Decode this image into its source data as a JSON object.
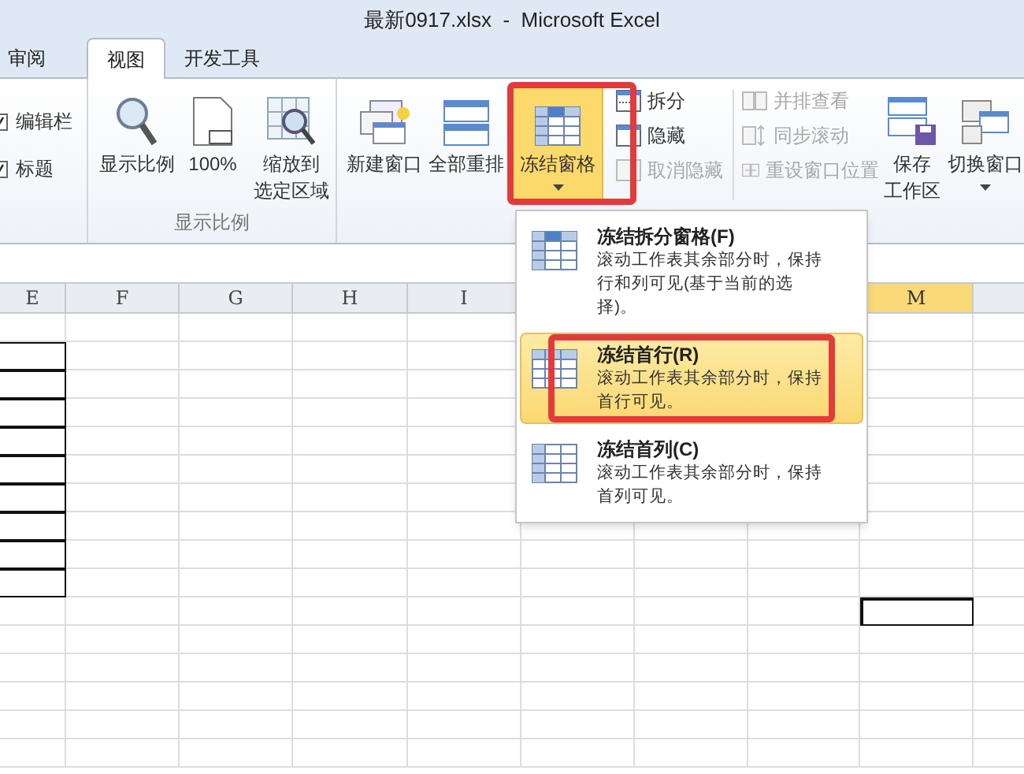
{
  "window": {
    "title": "最新0917.xlsx  -  Microsoft Excel"
  },
  "tabs": [
    {
      "label": "审阅",
      "selected": false
    },
    {
      "label": "视图",
      "selected": true
    },
    {
      "label": "开发工具",
      "selected": false
    }
  ],
  "show_group": {
    "checkboxes": [
      {
        "label": "编辑栏",
        "checked": true
      },
      {
        "label": "标题",
        "checked": true
      }
    ]
  },
  "zoom_group": {
    "label": "显示比例",
    "buttons": [
      {
        "kind": "zoom",
        "label": [
          "显示比例"
        ]
      },
      {
        "kind": "hundred",
        "label": [
          "100%"
        ]
      },
      {
        "kind": "selection",
        "label": [
          "缩放到",
          "选定区域"
        ]
      }
    ]
  },
  "window_group": {
    "large_buttons": [
      {
        "kind": "new",
        "label": [
          "新建窗口"
        ],
        "selected": false,
        "dropdown": false,
        "highlight_frame": false
      },
      {
        "kind": "arrange",
        "label": [
          "全部重排"
        ],
        "selected": false,
        "dropdown": false,
        "highlight_frame": false
      },
      {
        "kind": "freeze",
        "label": [
          "冻结窗格"
        ],
        "selected": true,
        "dropdown": true,
        "highlight_frame": true
      }
    ],
    "small_buttons": [
      {
        "kind": "split",
        "label": "拆分",
        "disabled": false
      },
      {
        "kind": "hide",
        "label": "隐藏",
        "disabled": false
      },
      {
        "kind": "unhide",
        "label": "取消隐藏",
        "disabled": true
      }
    ],
    "sync_buttons": [
      {
        "kind": "side",
        "label": "并排查看",
        "disabled": true
      },
      {
        "kind": "sync",
        "label": "同步滚动",
        "disabled": true
      },
      {
        "kind": "reset",
        "label": "重设窗口位置",
        "disabled": true
      }
    ],
    "end_buttons": [
      {
        "kind": "save",
        "label": [
          "保存",
          "工作区"
        ],
        "dropdown": false
      },
      {
        "kind": "switch",
        "label": [
          "切换窗口"
        ],
        "dropdown": true
      }
    ]
  },
  "freeze_menu": [
    {
      "kind": "panes",
      "title": "冻结拆分窗格(F)",
      "description": "滚动工作表其余部分时，保持行和列可见(基于当前的选择)。",
      "selected": false,
      "highlight_frame": false
    },
    {
      "kind": "row",
      "title": "冻结首行(R)",
      "description": "滚动工作表其余部分时，保持首行可见。",
      "selected": true,
      "highlight_frame": true
    },
    {
      "kind": "column",
      "title": "冻结首列(C)",
      "description": "滚动工作表其余部分时，保持首列可见。",
      "selected": false,
      "highlight_frame": false
    }
  ],
  "sheet": {
    "columns": [
      {
        "label": "E",
        "selected": false
      },
      {
        "label": "F",
        "selected": false
      },
      {
        "label": "G",
        "selected": false
      },
      {
        "label": "H",
        "selected": false
      },
      {
        "label": "I",
        "selected": false
      },
      {
        "label": "M",
        "selected": true
      }
    ],
    "rows": [
      {
        "bordered": false,
        "active": false
      },
      {
        "bordered": true,
        "active": false
      },
      {
        "bordered": true,
        "active": false
      },
      {
        "bordered": true,
        "active": false
      },
      {
        "bordered": true,
        "active": false
      },
      {
        "bordered": true,
        "active": false
      },
      {
        "bordered": true,
        "active": false
      },
      {
        "bordered": true,
        "active": false
      },
      {
        "bordered": true,
        "active": false
      },
      {
        "bordered": true,
        "active": false
      },
      {
        "bordered": false,
        "active": true
      },
      {
        "bordered": false,
        "active": false
      },
      {
        "bordered": false,
        "active": false
      },
      {
        "bordered": false,
        "active": false
      },
      {
        "bordered": false,
        "active": false
      },
      {
        "bordered": false,
        "active": false
      }
    ]
  }
}
